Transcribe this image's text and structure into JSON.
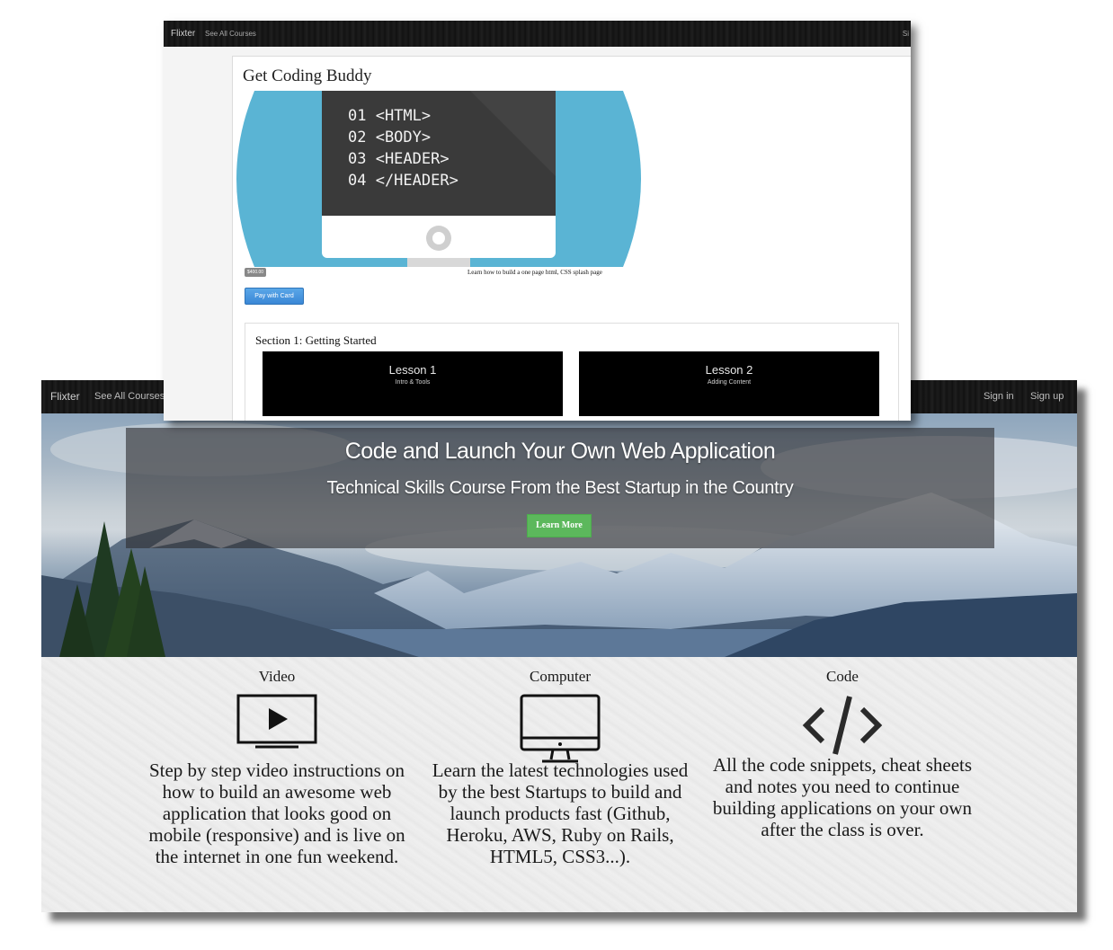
{
  "landing": {
    "nav": {
      "brand": "Flixter",
      "see_all": "See All Courses",
      "sign_in": "Sign in",
      "sign_up": "Sign up"
    },
    "hero": {
      "title": "Code and Launch Your Own Web Application",
      "subtitle": "Technical Skills Course From the Best Startup in the Country",
      "button": "Learn More"
    },
    "features": [
      {
        "title": "Video",
        "icon": "video-play-icon",
        "text": "Step by step video instructions on how to build an awesome web application that looks good on mobile (responsive) and is live on the internet in one fun weekend."
      },
      {
        "title": "Computer",
        "icon": "monitor-icon",
        "text": "Learn the latest technologies used by the best Startups to build and launch products fast (Github, Heroku, AWS, Ruby on Rails, HTML5, CSS3...)."
      },
      {
        "title": "Code",
        "icon": "code-brackets-icon",
        "text": "All the code snippets, cheat sheets and notes you need to continue building applications on your own after the class is over."
      }
    ]
  },
  "course_page": {
    "nav": {
      "brand": "Flixter",
      "see_all": "See All Courses",
      "right_partial": "Si"
    },
    "course": {
      "title": "Get Coding Buddy",
      "code_lines": [
        "01 <HTML>",
        "02 <BODY>",
        "03 <HEADER>",
        "04 </HEADER>"
      ],
      "price": "$400.00",
      "description": "Learn how to build a one page html, CSS splash page",
      "pay_button": "Pay with Card"
    },
    "section": {
      "title": "Section 1: Getting Started",
      "lessons": [
        {
          "name": "Lesson 1",
          "subtitle": "Intro & Tools"
        },
        {
          "name": "Lesson 2",
          "subtitle": "Adding Content"
        }
      ]
    }
  },
  "colors": {
    "hero_button": "#5cb85c",
    "pay_button": "#428bca",
    "course_image_bg": "#5ab4d4",
    "navbar": "#1a1a1a"
  }
}
